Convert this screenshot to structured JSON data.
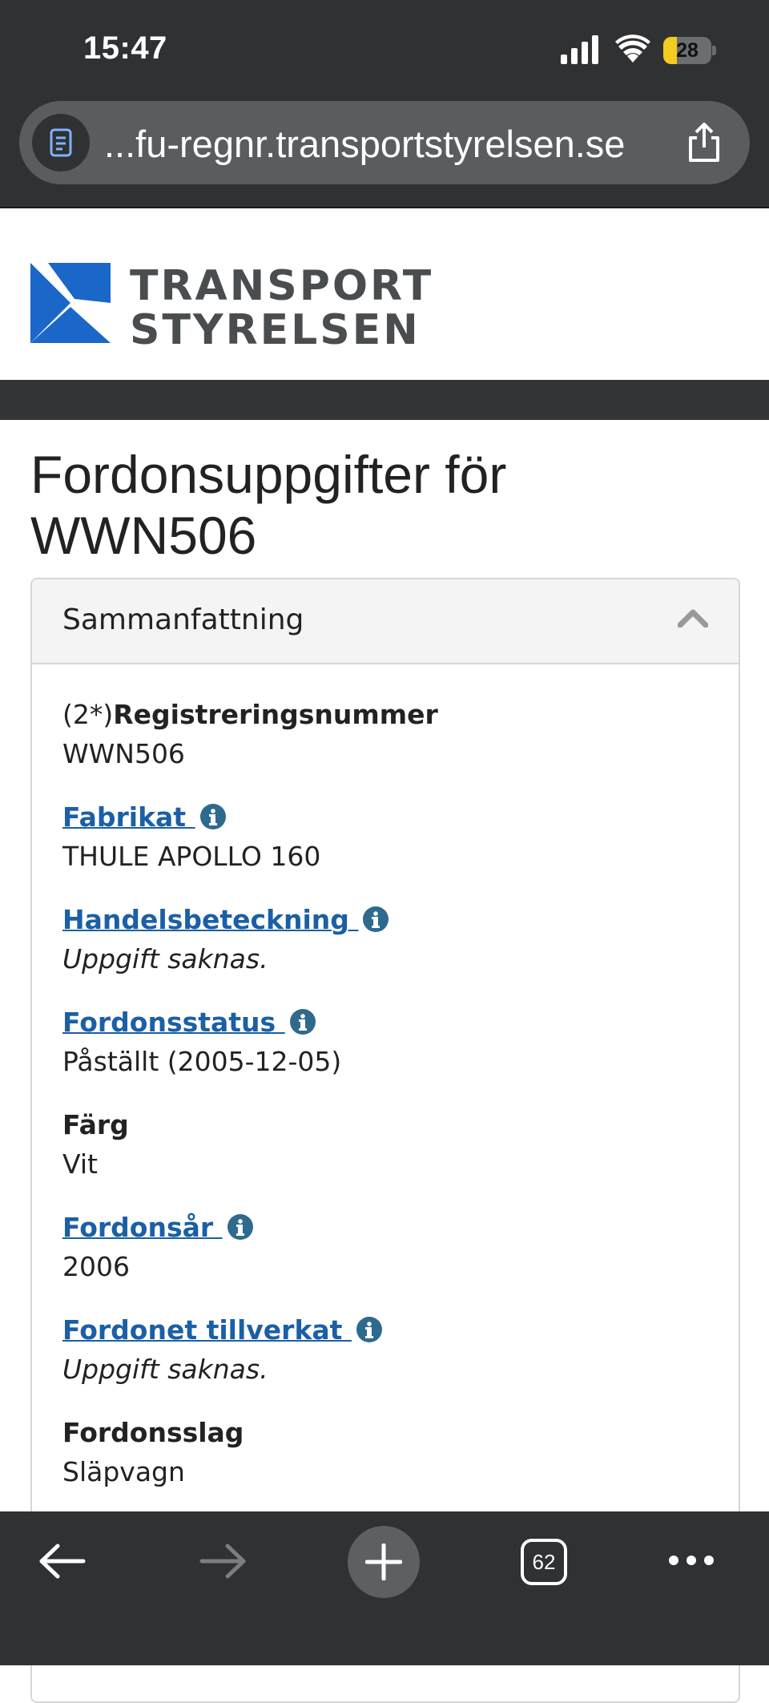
{
  "status_bar": {
    "time": "15:47",
    "battery_level": "28",
    "battery_fill_fraction": 0.28,
    "icons": [
      "signal-icon",
      "wifi-icon",
      "battery-icon"
    ]
  },
  "browser": {
    "url": "...fu-regnr.transportstyrelsen.se",
    "open_tabs": "62",
    "icons": [
      "page-icon",
      "share-icon",
      "back-arrow-icon",
      "forward-arrow-icon",
      "plus-icon",
      "tabs-icon",
      "more-icon"
    ]
  },
  "site": {
    "logo_line1": "TRANSPORT",
    "logo_line2": "STYRELSEN",
    "brand_blue": "#1a67c9"
  },
  "page": {
    "title": "Fordonsuppgifter för WWN506"
  },
  "summary": {
    "heading": "Sammanfattning",
    "fields": [
      {
        "prefix": "(2*)",
        "label": "Registreringsnummer",
        "value": "WWN506",
        "link": false,
        "info": false,
        "missing": false
      },
      {
        "prefix": "",
        "label": "Fabrikat ",
        "value": "THULE APOLLO 160",
        "link": true,
        "info": true,
        "missing": false
      },
      {
        "prefix": "",
        "label": "Handelsbeteckning ",
        "value": "Uppgift saknas.",
        "link": true,
        "info": true,
        "missing": true
      },
      {
        "prefix": "",
        "label": "Fordonsstatus ",
        "value": "Påställt (2005-12-05)",
        "link": true,
        "info": true,
        "missing": false
      },
      {
        "prefix": "",
        "label": "Färg",
        "value": "Vit",
        "link": false,
        "info": false,
        "missing": false
      },
      {
        "prefix": "",
        "label": "Fordonsår ",
        "value": "2006",
        "link": true,
        "info": true,
        "missing": false
      },
      {
        "prefix": "",
        "label": "Fordonet tillverkat ",
        "value": "Uppgift saknas.",
        "link": true,
        "info": true,
        "missing": true
      },
      {
        "prefix": "",
        "label": "Fordonsslag",
        "value": "Släpvagn",
        "link": false,
        "info": false,
        "missing": false
      }
    ]
  },
  "colors": {
    "link": "#1b5fa6",
    "info_icon": "#2e6a8e",
    "chrome_dark": "#2f3133"
  }
}
